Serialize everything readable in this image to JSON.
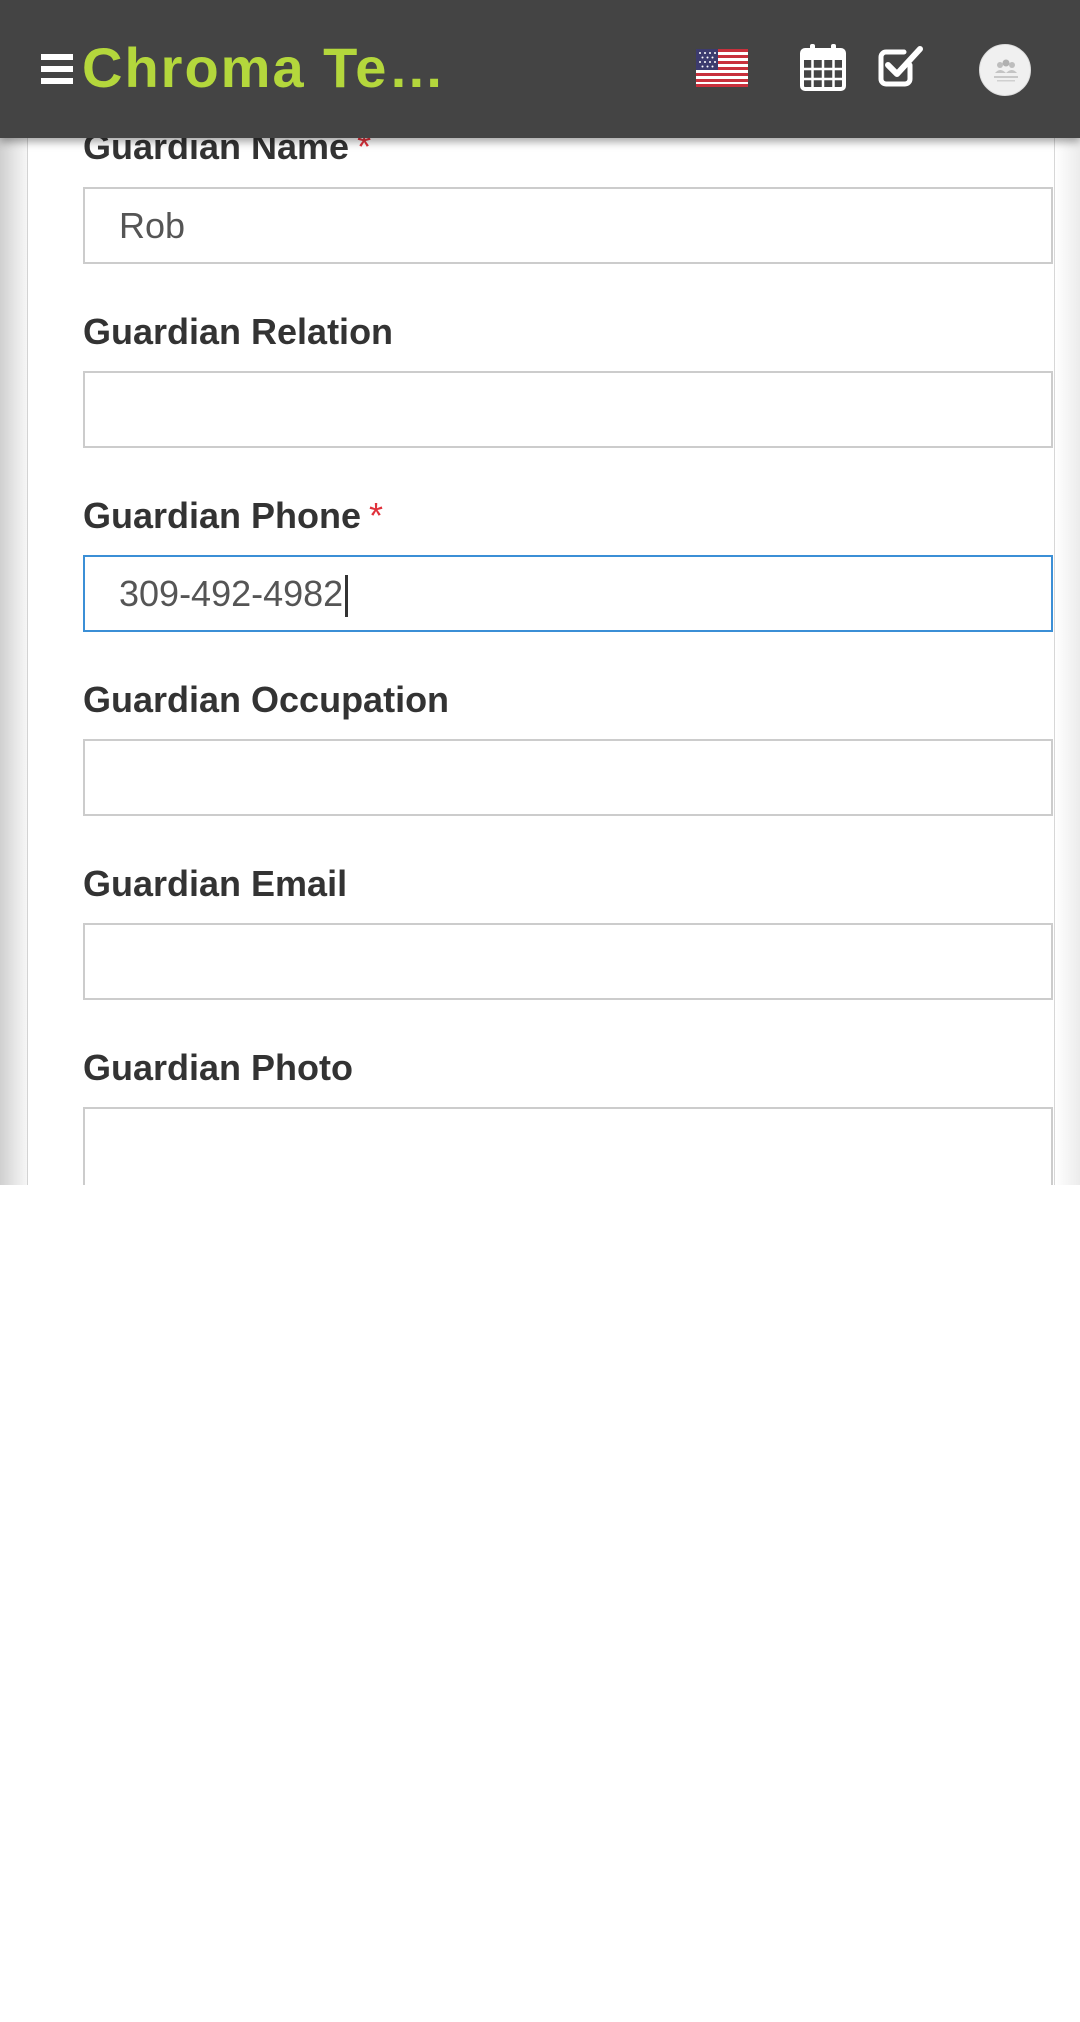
{
  "header": {
    "app_title": "Chroma Te…",
    "icons": [
      "menu-icon",
      "us-flag-icon",
      "calendar-icon",
      "checkbox-icon",
      "no-image-avatar"
    ],
    "accent_color": "#b4d73c",
    "bar_color": "#444444"
  },
  "form": {
    "required_mark": "*",
    "guardian_name": {
      "label": "Guardian Name",
      "value": "Rob",
      "required": true
    },
    "guardian_relation": {
      "label": "Guardian Relation",
      "value": "",
      "required": false
    },
    "guardian_phone": {
      "label": "Guardian Phone",
      "value": "309-492-4982",
      "required": true,
      "focused": true
    },
    "guardian_occupation": {
      "label": "Guardian Occupation",
      "value": "",
      "required": false
    },
    "guardian_email": {
      "label": "Guardian Email",
      "value": "",
      "required": false
    },
    "guardian_photo": {
      "label": "Guardian Photo",
      "value": "",
      "required": false
    }
  }
}
